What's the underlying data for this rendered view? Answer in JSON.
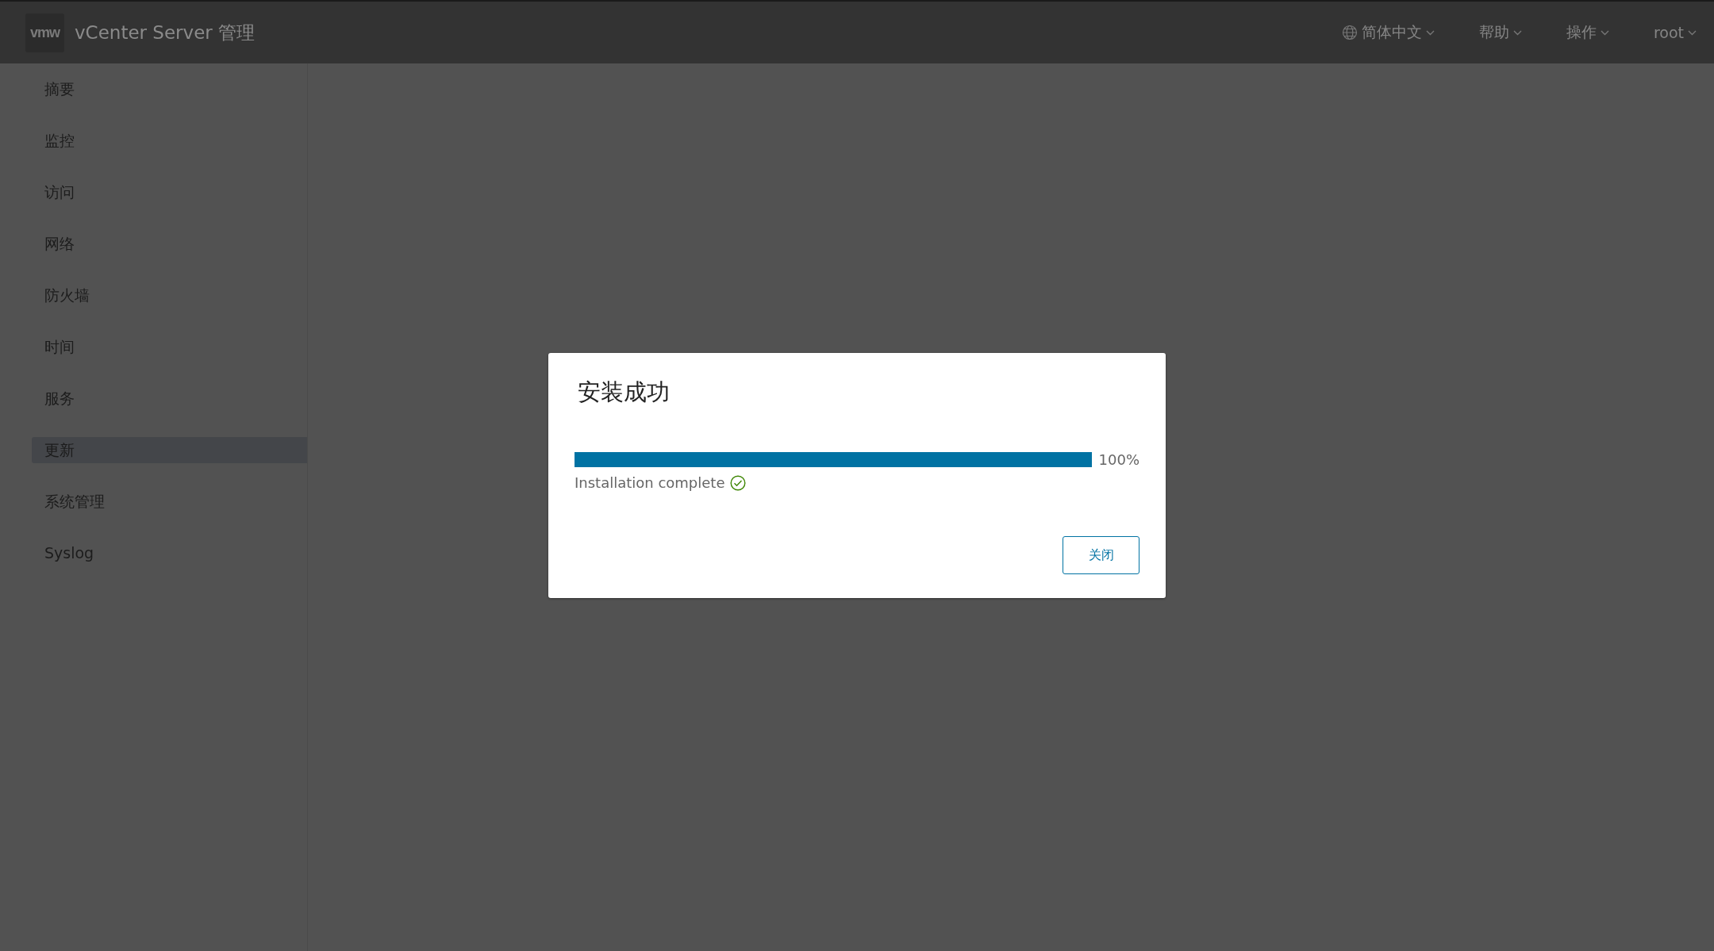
{
  "header": {
    "logo": "vmw",
    "title": "vCenter Server 管理",
    "menus": [
      {
        "label": "简体中文",
        "kind": "language"
      },
      {
        "label": "帮助",
        "kind": "menu"
      },
      {
        "label": "操作",
        "kind": "menu"
      },
      {
        "label": "root",
        "kind": "menu"
      }
    ]
  },
  "sidebar": {
    "items": [
      {
        "label": "摘要",
        "selected": false
      },
      {
        "label": "监控",
        "selected": false
      },
      {
        "label": "访问",
        "selected": false
      },
      {
        "label": "网络",
        "selected": false
      },
      {
        "label": "防火墙",
        "selected": false
      },
      {
        "label": "时间",
        "selected": false
      },
      {
        "label": "服务",
        "selected": false
      },
      {
        "label": "更新",
        "selected": true
      },
      {
        "label": "系统管理",
        "selected": false
      },
      {
        "label": "Syslog",
        "selected": false
      }
    ]
  },
  "dialog": {
    "title": "安装成功",
    "progress": {
      "level": 1,
      "reading": "100%"
    },
    "status": "Installation complete",
    "buttons": [
      "关闭"
    ]
  }
}
